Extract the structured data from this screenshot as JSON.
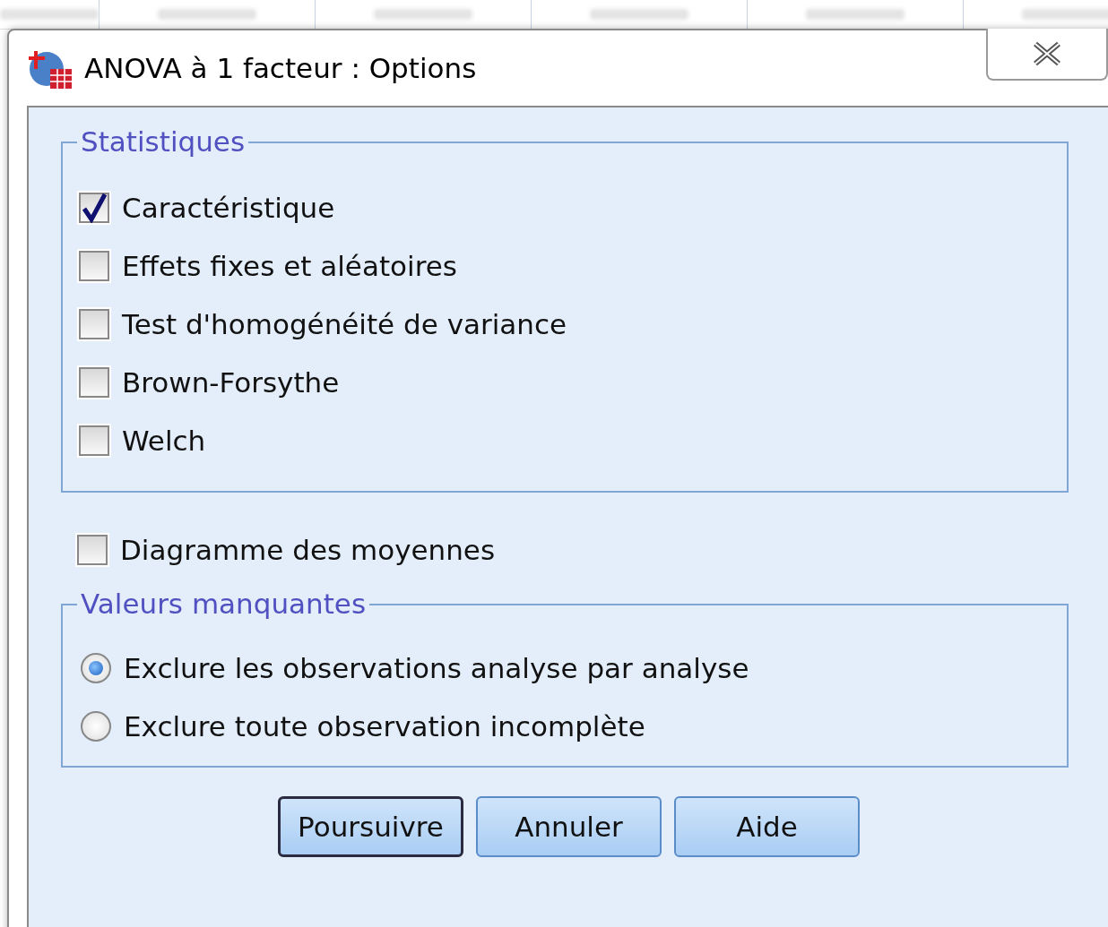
{
  "window": {
    "title": "ANOVA à 1 facteur : Options"
  },
  "statistics": {
    "legend": "Statistiques",
    "options": [
      {
        "label": "Caractéristique",
        "checked": true
      },
      {
        "label": "Effets fixes et aléatoires",
        "checked": false
      },
      {
        "label": "Test d'homogénéité de variance",
        "checked": false
      },
      {
        "label": "Brown-Forsythe",
        "checked": false
      },
      {
        "label": "Welch",
        "checked": false
      }
    ]
  },
  "means_plot": {
    "label": "Diagramme des moyennes",
    "checked": false
  },
  "missing_values": {
    "legend": "Valeurs manquantes",
    "options": [
      {
        "label": "Exclure les observations analyse par analyse",
        "selected": true
      },
      {
        "label": "Exclure toute observation incomplète",
        "selected": false
      }
    ]
  },
  "buttons": [
    {
      "label": "Poursuivre",
      "default": true
    },
    {
      "label": "Annuler",
      "default": false
    },
    {
      "label": "Aide",
      "default": false
    }
  ]
}
